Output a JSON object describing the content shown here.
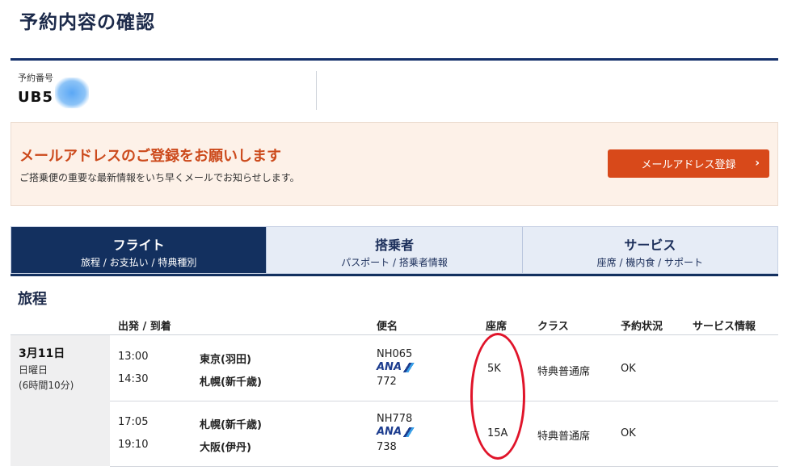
{
  "header": {
    "title": "予約内容の確認"
  },
  "booking": {
    "label": "予約番号",
    "number_visible": "UB5"
  },
  "email_banner": {
    "heading": "メールアドレスのご登録をお願いします",
    "subtext": "ご搭乗便の重要な最新情報をいち早くメールでお知らせします。",
    "button_label": "メールアドレス登録",
    "button_chevron": "›"
  },
  "tabs": [
    {
      "title": "フライト",
      "sub": "旅程 / お支払い / 特典種別",
      "active": true
    },
    {
      "title": "搭乗者",
      "sub": "パスポート / 搭乗者情報",
      "active": false
    },
    {
      "title": "サービス",
      "sub": "座席 / 機内食 / サポート",
      "active": false
    }
  ],
  "itinerary": {
    "section_title": "旅程",
    "columns": {
      "depart_arrive": "出発 / 到着",
      "flight": "便名",
      "seat": "座席",
      "class": "クラス",
      "status": "予約状況",
      "service": "サービス情報"
    },
    "date": {
      "main": "3月11日",
      "weekday": "日曜日",
      "duration": "(6時間10分)"
    },
    "segments": [
      {
        "dep_time": "13:00",
        "dep_city": "東京(羽田)",
        "arr_time": "14:30",
        "arr_city": "札幌(新千歳)",
        "flight_no": "NH065",
        "airline_logo": "ANA",
        "aircraft": "772",
        "seat": "5K",
        "class": "特典普通席",
        "status": "OK"
      },
      {
        "dep_time": "17:05",
        "dep_city": "札幌(新千歳)",
        "arr_time": "19:10",
        "arr_city": "大阪(伊丹)",
        "flight_no": "NH778",
        "airline_logo": "ANA",
        "aircraft": "738",
        "seat": "15A",
        "class": "特典普通席",
        "status": "OK"
      }
    ]
  },
  "colors": {
    "navy": "#13305f",
    "accent_orange": "#d8491a",
    "banner_bg": "#fdf1e8",
    "annotation_red": "#e0142a"
  }
}
